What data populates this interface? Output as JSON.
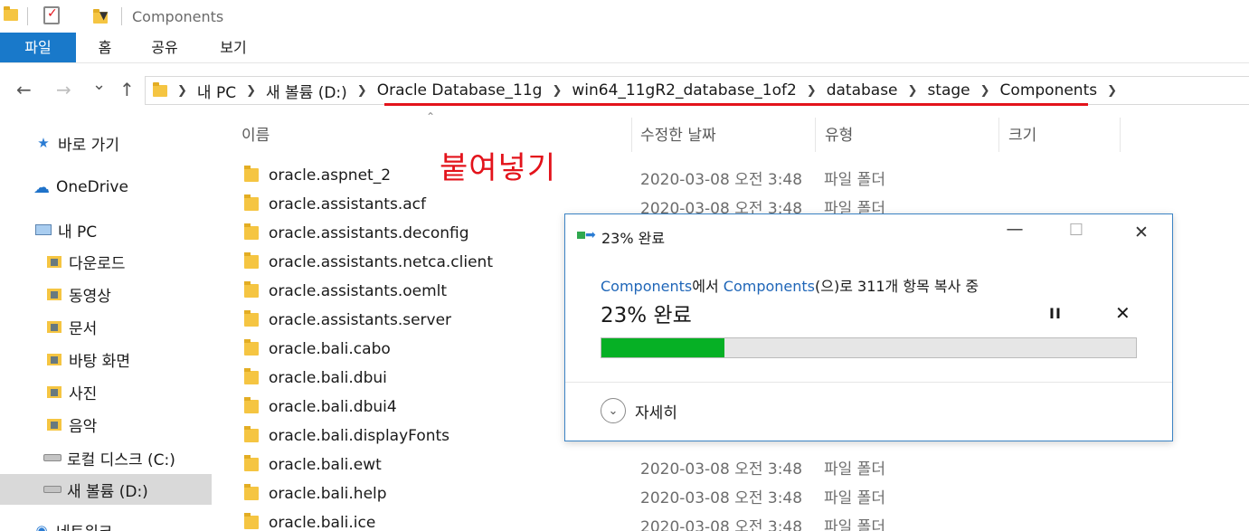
{
  "window": {
    "title": "Components"
  },
  "quick_access": {
    "icons": [
      "folder-icon",
      "properties-checkmark-icon",
      "new-folder-icon",
      "customize-dropdown-icon"
    ]
  },
  "ribbon": {
    "tabs": [
      "파일",
      "홈",
      "공유",
      "보기"
    ]
  },
  "nav": {
    "back_icon": "←",
    "forward_icon": "→",
    "recent_icon": "⌄",
    "up_icon": "↑"
  },
  "breadcrumb": [
    "내 PC",
    "새 볼륨 (D:)",
    "Oracle Database_11g",
    "win64_11gR2_database_1of2",
    "database",
    "stage",
    "Components"
  ],
  "sidebar": {
    "items": [
      {
        "label": "바로 가기",
        "icon": "star-icon"
      },
      {
        "label": "OneDrive",
        "icon": "cloud-icon"
      },
      {
        "label": "내 PC",
        "icon": "pc-icon"
      },
      {
        "label": "다운로드",
        "icon": "download-folder-icon"
      },
      {
        "label": "동영상",
        "icon": "video-folder-icon"
      },
      {
        "label": "문서",
        "icon": "document-folder-icon"
      },
      {
        "label": "바탕 화면",
        "icon": "desktop-folder-icon"
      },
      {
        "label": "사진",
        "icon": "pictures-folder-icon"
      },
      {
        "label": "음악",
        "icon": "music-folder-icon"
      },
      {
        "label": "로컬 디스크 (C:)",
        "icon": "drive-icon"
      },
      {
        "label": "새 볼륨 (D:)",
        "icon": "drive-icon"
      },
      {
        "label": "네트워크",
        "icon": "network-icon"
      }
    ]
  },
  "columns": {
    "name": "이름",
    "date": "수정한 날짜",
    "type": "유형",
    "size": "크기"
  },
  "files": [
    {
      "name": "oracle.aspnet_2",
      "date": "2020-03-08 오전 3:48",
      "type": "파일 폴더"
    },
    {
      "name": "oracle.assistants.acf",
      "date": "2020-03-08 오전 3:48",
      "type": "파일 폴더"
    },
    {
      "name": "oracle.assistants.deconfig",
      "date": "",
      "type": ""
    },
    {
      "name": "oracle.assistants.netca.client",
      "date": "",
      "type": ""
    },
    {
      "name": "oracle.assistants.oemlt",
      "date": "",
      "type": ""
    },
    {
      "name": "oracle.assistants.server",
      "date": "",
      "type": ""
    },
    {
      "name": "oracle.bali.cabo",
      "date": "",
      "type": ""
    },
    {
      "name": "oracle.bali.dbui",
      "date": "",
      "type": ""
    },
    {
      "name": "oracle.bali.dbui4",
      "date": "",
      "type": ""
    },
    {
      "name": "oracle.bali.displayFonts",
      "date": "",
      "type": ""
    },
    {
      "name": "oracle.bali.ewt",
      "date": "2020-03-08 오전 3:48",
      "type": "파일 폴더"
    },
    {
      "name": "oracle.bali.help",
      "date": "2020-03-08 오전 3:48",
      "type": "파일 폴더"
    },
    {
      "name": "oracle.bali.ice",
      "date": "2020-03-08 오전 3:48",
      "type": "파일 폴더"
    }
  ],
  "annotation": {
    "paste_label": "붙여넣기"
  },
  "copy_dialog": {
    "title": "23% 완료",
    "source": "Components",
    "middle": "에서 ",
    "dest": "Components",
    "tail": "(으)로 311개 항목 복사 중",
    "status": "23% 완료",
    "progress": 0.23,
    "pause_label": "II",
    "cancel_label": "✕",
    "details_label": "자세히",
    "minimize_label": "—",
    "maximize_label": "☐",
    "close_label": "✕",
    "progress_color": "#06b025"
  }
}
